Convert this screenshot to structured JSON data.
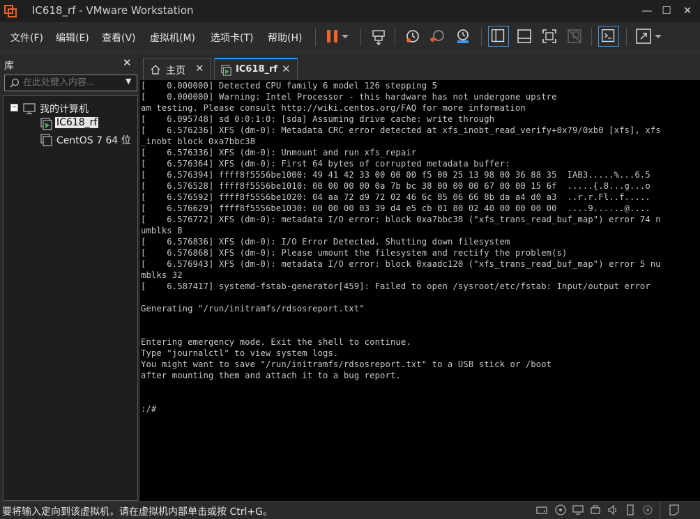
{
  "window": {
    "title": "IC618_rf - VMware Workstation"
  },
  "menu": {
    "items": [
      "文件(F)",
      "编辑(E)",
      "查看(V)",
      "虚拟机(M)",
      "选项卡(T)",
      "帮助(H)"
    ]
  },
  "toolbar": {
    "icons": [
      "pause-icon",
      "dropdown-icon",
      "send-ctrl-alt-del-icon",
      "snapshot-icon",
      "revert-snapshot-icon",
      "snapshot-manager-icon",
      "show-library-icon",
      "thumbnail-bar-icon",
      "fullscreen-icon",
      "unity-icon",
      "console-view-icon",
      "stretch-icon",
      "stretch-dropdown-icon"
    ],
    "accent": "#f0642a"
  },
  "library": {
    "title": "库",
    "search_placeholder": "在此处键入内容...",
    "tree": {
      "root": "我的计算机",
      "vms": [
        "IC618_rf",
        "CentOS 7 64 位"
      ]
    }
  },
  "tabs": [
    {
      "label": "主页",
      "icon": "home-icon"
    },
    {
      "label": "IC618_rf",
      "icon": "vm-running-icon"
    }
  ],
  "console": {
    "lines": [
      "[    0.000000] Detected CPU family 6 model 126 stepping 5",
      "[    0.000000] Warning: Intel Processor - this hardware has not undergone upstre",
      "am testing. Please consult http://wiki.centos.org/FAQ for more information",
      "[    6.095748] sd 0:0:1:0: [sda] Assuming drive cache: write through",
      "[    6.576236] XFS (dm-0): Metadata CRC error detected at xfs_inobt_read_verify+0x79/0xb0 [xfs], xfs",
      "_inobt block 0xa7bbc38",
      "[    6.576336] XFS (dm-0): Unmount and run xfs_repair",
      "[    6.576364] XFS (dm-0): First 64 bytes of corrupted metadata buffer:",
      "[    6.576394] ffff8f5556be1000: 49 41 42 33 00 00 00 f5 00 25 13 98 00 36 88 35  IAB3.....%...6.5",
      "[    6.576528] ffff8f5556be1010: 00 00 00 00 0a 7b bc 38 00 00 00 67 00 00 15 6f  .....{.8...g...o",
      "[    6.576592] ffff8f5556be1020: 04 aa 72 d9 72 02 46 6c 85 06 66 8b da a4 d0 a3  ..r.r.Fl..f.....",
      "[    6.576629] ffff8f5556be1030: 00 00 00 03 39 d4 e5 cb 01 80 02 40 00 00 00 00  ....9......@....",
      "[    6.576772] XFS (dm-0): metadata I/O error: block 0xa7bbc38 (\"xfs_trans_read_buf_map\") error 74 n",
      "umblks 8",
      "[    6.576836] XFS (dm-0): I/O Error Detected. Shutting down filesystem",
      "[    6.576868] XFS (dm-0): Please umount the filesystem and rectify the problem(s)",
      "[    6.576943] XFS (dm-0): metadata I/O error: block 0xaadc120 (\"xfs_trans_read_buf_map\") error 5 nu",
      "mblks 32",
      "[    6.587417] systemd-fstab-generator[459]: Failed to open /sysroot/etc/fstab: Input/output error",
      "",
      "Generating \"/run/initramfs/rdsosreport.txt\"",
      "",
      "",
      "Entering emergency mode. Exit the shell to continue.",
      "Type \"journalctl\" to view system logs.",
      "You might want to save \"/run/initramfs/rdsosreport.txt\" to a USB stick or /boot",
      "after mounting them and attach it to a bug report.",
      "",
      "",
      ":/#"
    ]
  },
  "statusbar": {
    "text": "要将输入定向到该虚拟机，请在虚拟机内部单击或按 Ctrl+G。",
    "icons": [
      "hard-disk-icon",
      "cd-dvd-icon",
      "network-icon",
      "usb-icon",
      "printer-icon",
      "sound-icon",
      "display-icon",
      "camera-icon",
      "message-icon"
    ]
  }
}
